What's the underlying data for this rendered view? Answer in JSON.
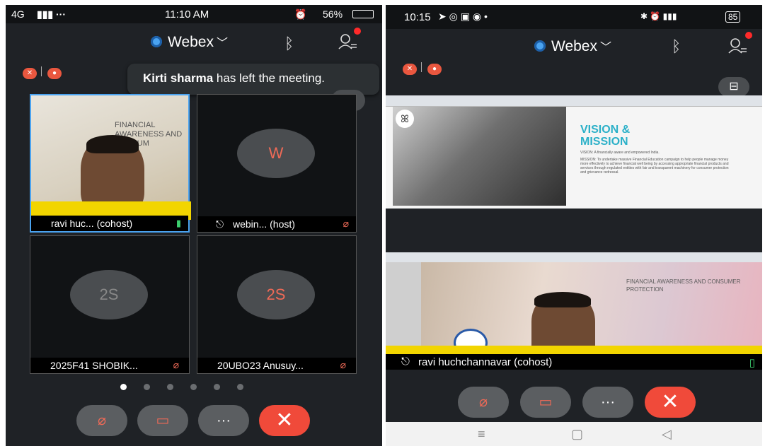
{
  "left": {
    "status": {
      "network": "4G",
      "time": "11:10 AM",
      "battery": "56%"
    },
    "app_name": "Webex",
    "toast": {
      "name": "Kirti sharma",
      "message": " has left the meeting."
    },
    "tiles": [
      {
        "label": "ravi huc... (cohost)"
      },
      {
        "label": "webin... (host)",
        "initials": "W"
      },
      {
        "label": "2025F41 SHOBIK...",
        "initials": "2S"
      },
      {
        "label": "20UBO23 Anusuy...",
        "initials": "2S"
      }
    ],
    "shared_text": "FINANCIAL AWARENESS AND CONSUM",
    "more_label": "···"
  },
  "right": {
    "status": {
      "time": "10:15",
      "battery": "85"
    },
    "app_name": "Webex",
    "slide": {
      "title_line1": "VISION &",
      "title_line2": "MISSION",
      "vision": "VISION: A financially aware and empowered India.",
      "mission": "MISSION: To undertake massive Financial Education campaign to help people manage money more effectively to achieve financial well being by accessing appropriate financial products and services through regulated entities with fair and transparent machinery for consumer protection and grievance redressal."
    },
    "video_text": "FINANCIAL AWARENESS AND CONSUMER PROTECTION",
    "video_label": "ravi huchchannavar (cohost)",
    "more_label": "···"
  },
  "colors": {
    "accent": "#4aa3f0",
    "danger": "#f04a3a",
    "muted_red": "#ef6a57"
  }
}
